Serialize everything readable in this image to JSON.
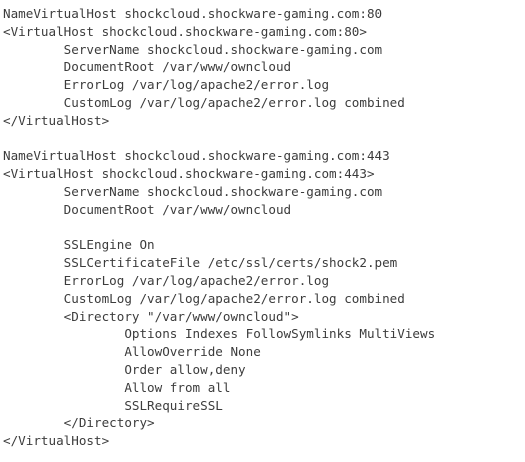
{
  "editor": {
    "lines": [
      "NameVirtualHost shockcloud.shockware-gaming.com:80",
      "<VirtualHost shockcloud.shockware-gaming.com:80>",
      "        ServerName shockcloud.shockware-gaming.com",
      "        DocumentRoot /var/www/owncloud",
      "        ErrorLog /var/log/apache2/error.log",
      "        CustomLog /var/log/apache2/error.log combined",
      "</VirtualHost>",
      "",
      "NameVirtualHost shockcloud.shockware-gaming.com:443",
      "<VirtualHost shockcloud.shockware-gaming.com:443>",
      "        ServerName shockcloud.shockware-gaming.com",
      "        DocumentRoot /var/www/owncloud",
      "",
      "        SSLEngine On",
      "        SSLCertificateFile /etc/ssl/certs/shock2.pem",
      "        ErrorLog /var/log/apache2/error.log",
      "        CustomLog /var/log/apache2/error.log combined",
      "        <Directory \"/var/www/owncloud\">",
      "                Options Indexes FollowSymlinks MultiViews",
      "                AllowOverride None",
      "                Order allow,deny",
      "                Allow from all",
      "                SSLRequireSSL",
      "        </Directory>",
      "</VirtualHost>"
    ]
  }
}
